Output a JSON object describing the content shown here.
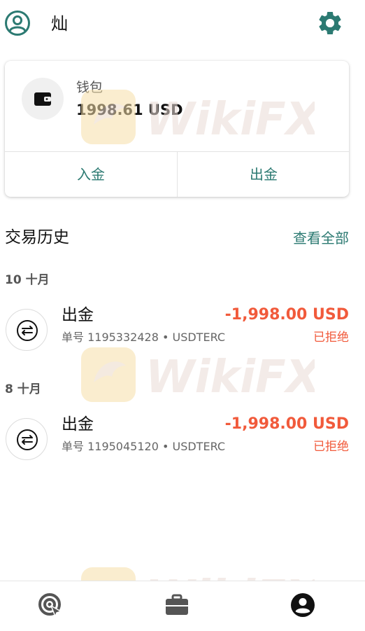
{
  "header": {
    "user_name": "灿",
    "avatar_icon": "account-circle-outline-icon",
    "settings_icon": "gear-icon"
  },
  "wallet": {
    "icon": "wallet-icon",
    "label": "钱包",
    "balance": "1998.61 USD",
    "deposit_label": "入金",
    "withdraw_label": "出金"
  },
  "history": {
    "title": "交易历史",
    "view_all_label": "查看全部",
    "groups": [
      {
        "label": "10 十月",
        "transactions": [
          {
            "type": "出金",
            "subtitle": "单号 1195332428 • USDTERC",
            "amount": "-1,998.00 USD",
            "status": "已拒绝",
            "icon": "transfer-arrows-icon"
          }
        ]
      },
      {
        "label": "8 十月",
        "transactions": [
          {
            "type": "出金",
            "subtitle": "单号 1195045120 • USDTERC",
            "amount": "-1,998.00 USD",
            "status": "已拒绝",
            "icon": "transfer-arrows-icon"
          }
        ]
      }
    ]
  },
  "watermark": {
    "text": "WikiFX"
  },
  "bottom_nav": {
    "items": [
      {
        "icon": "explore-target-icon",
        "active": false
      },
      {
        "icon": "briefcase-icon",
        "active": false
      },
      {
        "icon": "account-circle-icon",
        "active": true
      }
    ]
  },
  "colors": {
    "accent": "#2c7a72",
    "negative": "#f15a3b",
    "muted_text": "#666666",
    "nav_inactive": "#555555",
    "nav_active": "#111111"
  }
}
